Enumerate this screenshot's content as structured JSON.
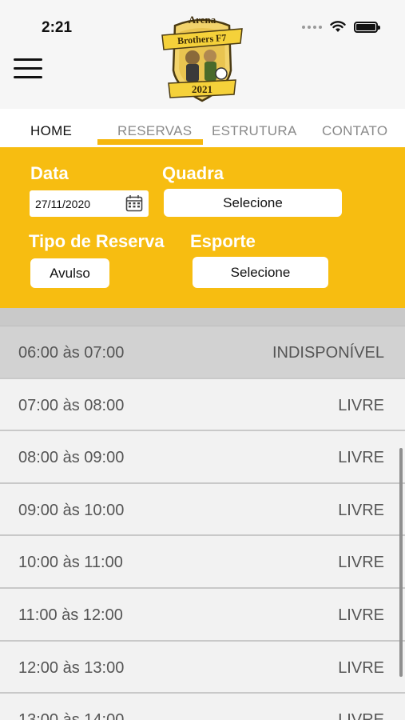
{
  "status_bar": {
    "time": "2:21"
  },
  "logo": {
    "line1": "Arena",
    "line2": "Brothers F7",
    "year": "2021"
  },
  "tabs": [
    {
      "label": "HOME"
    },
    {
      "label": "RESERVAS"
    },
    {
      "label": "ESTRUTURA"
    },
    {
      "label": "CONTATO"
    }
  ],
  "form": {
    "data_label": "Data",
    "data_value": "27/11/2020",
    "quadra_label": "Quadra",
    "quadra_value": "Selecione",
    "tipo_label": "Tipo de Reserva",
    "tipo_value": "Avulso",
    "esporte_label": "Esporte",
    "esporte_value": "Selecione"
  },
  "slots": [
    {
      "range": "06:00 às 07:00",
      "status": "INDISPONÍVEL"
    },
    {
      "range": "07:00 às 08:00",
      "status": "LIVRE"
    },
    {
      "range": "08:00 às 09:00",
      "status": "LIVRE"
    },
    {
      "range": "09:00 às 10:00",
      "status": "LIVRE"
    },
    {
      "range": "10:00 às 11:00",
      "status": "LIVRE"
    },
    {
      "range": "11:00 às 12:00",
      "status": "LIVRE"
    },
    {
      "range": "12:00 às 13:00",
      "status": "LIVRE"
    },
    {
      "range": "13:00 às 14:00",
      "status": "LIVRE"
    }
  ],
  "colors": {
    "accent": "#f7bd11",
    "tab_indicator": "#f6b70e",
    "unavailable_row": "#d2d2d2"
  }
}
